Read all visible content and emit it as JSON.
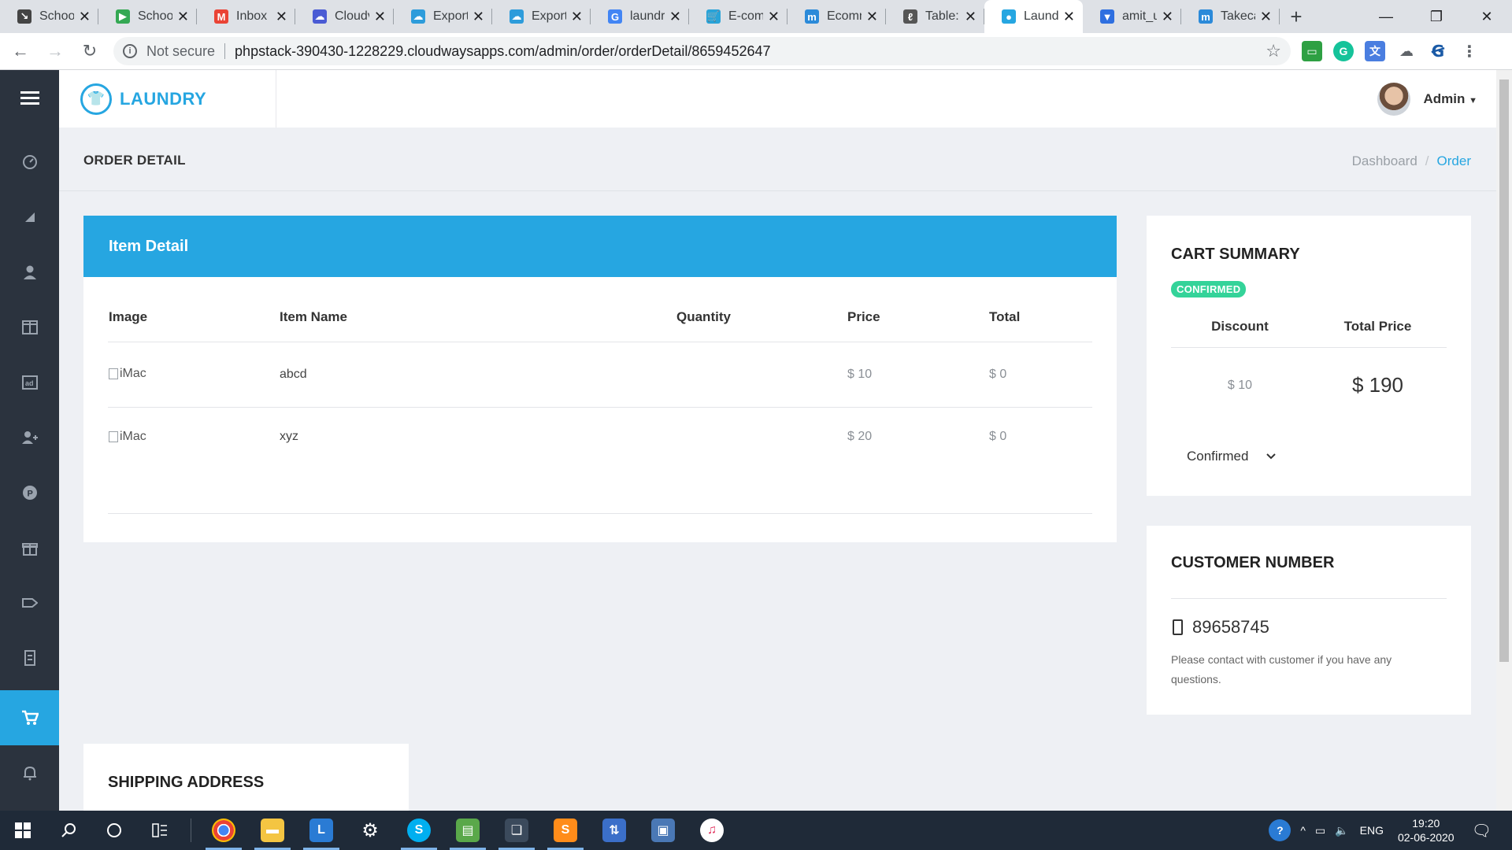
{
  "browser": {
    "tabs": [
      {
        "label": "School",
        "fav_color": "#444",
        "fav_glyph": "↘"
      },
      {
        "label": "School",
        "fav_color": "#34a853",
        "fav_glyph": "▶"
      },
      {
        "label": "Inbox (",
        "fav_color": "#ea4335",
        "fav_glyph": "M"
      },
      {
        "label": "Cloudv",
        "fav_color": "#4a5bd4",
        "fav_glyph": "☁"
      },
      {
        "label": "Export",
        "fav_color": "#2d9cdb",
        "fav_glyph": "☁"
      },
      {
        "label": "Export",
        "fav_color": "#2d9cdb",
        "fav_glyph": "☁"
      },
      {
        "label": "laundr",
        "fav_color": "#4285f4",
        "fav_glyph": "G"
      },
      {
        "label": "E-com",
        "fav_color": "#29a3d8",
        "fav_glyph": "🛒"
      },
      {
        "label": "Ecomn",
        "fav_color": "#2b8ad9",
        "fav_glyph": "m"
      },
      {
        "label": "Table:",
        "fav_color": "#555",
        "fav_glyph": "ℓ"
      },
      {
        "label": "Laundr",
        "fav_color": "#26a6e1",
        "fav_glyph": "●",
        "active": true
      },
      {
        "label": "amit_u",
        "fav_color": "#2e6fe0",
        "fav_glyph": "▼"
      },
      {
        "label": "Takeca",
        "fav_color": "#2b8ad9",
        "fav_glyph": "m"
      }
    ],
    "not_secure": "Not secure",
    "url": "phpstack-390430-1228229.cloudwaysapps.com/admin/order/orderDetail/8659452647"
  },
  "app": {
    "brand": "LAUNDRY",
    "user": "Admin",
    "page_title": "ORDER DETAIL",
    "breadcrumb": [
      "Dashboard",
      "Order"
    ]
  },
  "items": {
    "title": "Item Detail",
    "columns": [
      "Image",
      "Item Name",
      "Quantity",
      "Price",
      "Total"
    ],
    "rows": [
      {
        "image_alt": "iMac",
        "name": "abcd",
        "quantity": "",
        "price": "$ 10",
        "total": "$ 0"
      },
      {
        "image_alt": "iMac",
        "name": "xyz",
        "quantity": "",
        "price": "$ 20",
        "total": "$ 0"
      }
    ]
  },
  "cart": {
    "title": "CART SUMMARY",
    "status_badge": "CONFIRMED",
    "discount_label": "Discount",
    "total_label": "Total Price",
    "discount": "$ 10",
    "total": "$ 190",
    "status_select": "Confirmed"
  },
  "customer": {
    "title": "CUSTOMER NUMBER",
    "phone": "89658745",
    "note": "Please contact with customer if you have any questions."
  },
  "shipping": {
    "title": "SHIPPING ADDRESS"
  },
  "taskbar": {
    "lang": "ENG",
    "time": "19:20",
    "date": "02-06-2020"
  }
}
